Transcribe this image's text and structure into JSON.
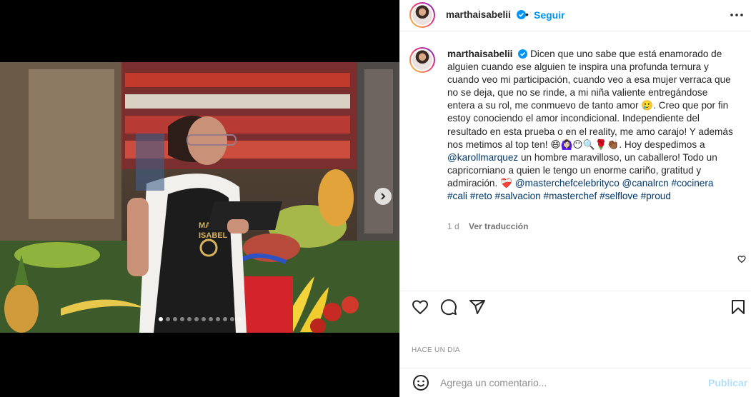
{
  "post": {
    "username": "marthaisabelii",
    "follow_label": "Seguir",
    "separator": "•",
    "more_label": "•••",
    "caption_user": "marthaisabelii",
    "caption_p1": "Dicen que uno sabe que está enamorado de alguien cuando ese alguien te inspira una profunda ternura y cuando veo mi participación, cuando veo a esa mujer verraca que no se deja, que no se rinde, a mi niña valiente entregándose entera a su rol, me conmuevo de tanto amor 🥲. Creo que por fin estoy conociendo el amor incondicional. Independiente del resultado en esta prueba o en el reality, me amo carajo! Y además nos metimos al top ten! 😄🙆🏻‍♀️😶🔍🌹👏🏾. Hoy despedimos a ",
    "mention_1": "@karollmarquez",
    "caption_p2": " un hombre maravilloso, un caballero! Todo un capricorniano a quien le tengo un enorme cariño, gratitud y admiración. ❤️‍🩹 ",
    "mention_2": "@masterchefcelebrityco",
    "mention_3": "@canalrcn",
    "tag_1": "#cocinera",
    "tag_2": "#cali",
    "tag_3": "#reto",
    "tag_4": "#salvacion",
    "tag_5": "#masterchef",
    "tag_6": "#selflove",
    "tag_7": "#proud",
    "time_ago": "1 d",
    "translate_label": "Ver traducción",
    "date_label": "HACE UN DIA",
    "comment_placeholder": "Agrega un comentario...",
    "publish_label": "Publicar"
  },
  "carousel": {
    "slide_count": 12,
    "active_index": 0
  },
  "icons": {
    "verified": "verified-badge-icon",
    "like": "heart-icon",
    "comment": "comment-icon",
    "share": "send-icon",
    "save": "bookmark-icon",
    "emoji": "emoji-icon",
    "next": "chevron-right-icon"
  },
  "colors": {
    "accent": "#0095f6",
    "link": "#00376b",
    "muted": "#8e8e8e",
    "publish_disabled": "#b2dffc"
  }
}
